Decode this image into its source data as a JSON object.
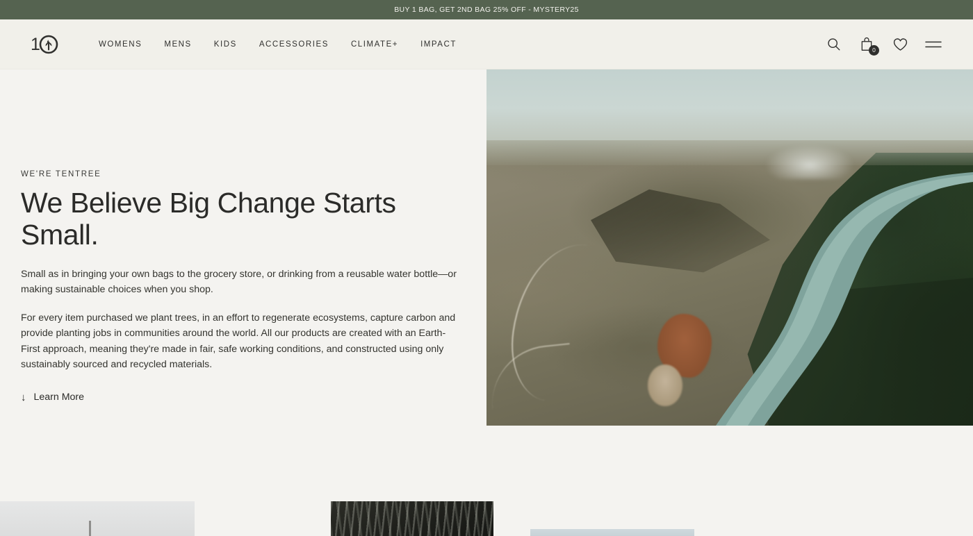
{
  "announcement": {
    "text": "BUY 1 BAG, GET 2ND BAG 25% OFF - MYSTERY25",
    "background_color": "#556350"
  },
  "header": {
    "logo_alt": "tentree logo",
    "logo_text": "10",
    "nav": [
      {
        "label": "WOMENS"
      },
      {
        "label": "MENS"
      },
      {
        "label": "KIDS"
      },
      {
        "label": "ACCESSORIES"
      },
      {
        "label": "CLIMATE+"
      },
      {
        "label": "IMPACT"
      }
    ],
    "actions": {
      "search_label": "Search",
      "cart_label": "Cart",
      "cart_count": "0",
      "wishlist_label": "Wishlist",
      "menu_label": "Menu"
    },
    "background_color": "#f1f0ea"
  },
  "hero": {
    "eyebrow": "WE'RE TENTREE",
    "title": "We Believe Big Change Starts Small.",
    "paragraph_1": "Small as in bringing your own bags to the grocery store, or drinking from a reusable water bottle—or making sustainable choices when you shop.",
    "paragraph_2": "For every item purchased we plant trees, in an effort to regenerate ecosystems, capture carbon and provide planting jobs in communities around the world. All our products are created with an Earth-First approach, meaning they're made in fair, safe working conditions, and constructed using only sustainably sourced and recycled materials.",
    "cta_icon": "↓",
    "cta_label": "Learn More",
    "image_description": "Aerial photograph of an arid landscape with a winding teal river separating dry terrain from dense green forest"
  },
  "bottom_tiles": [
    {
      "name": "tile-light",
      "description": "Pale grey product image, partially visible"
    },
    {
      "name": "tile-dark",
      "description": "Dark forest floor image, partially visible"
    },
    {
      "name": "tile-blue",
      "description": "Pale blue image, partially visible"
    }
  ],
  "theme": {
    "page_background": "#f4f3f0",
    "text_color": "#2e2e2c",
    "accent_green": "#556350"
  }
}
